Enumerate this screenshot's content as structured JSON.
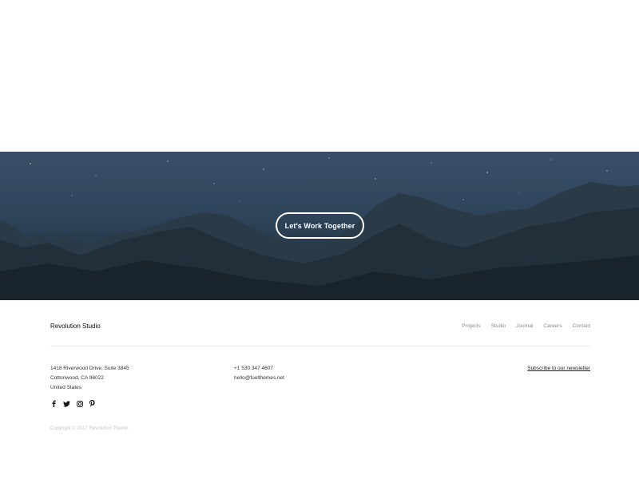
{
  "hero": {
    "cta_label": "Let's Work Together"
  },
  "footer": {
    "brand": "Revolution Studio",
    "nav": [
      "Projects",
      "Studio",
      "Journal",
      "Careers",
      "Contact"
    ],
    "address": [
      "1418 Riverwood Drive, Suite 3845",
      "Cottonwood, CA 96022",
      "United States"
    ],
    "contact": {
      "phone": "+1 530 347 4607",
      "email": "hello@fuelthemes.net"
    },
    "newsletter_label": "Subscribe to our newsletter",
    "social_icons": [
      "facebook-icon",
      "twitter-icon",
      "instagram-icon",
      "pinterest-icon"
    ],
    "copyright": "Copyright © 2017 Revolution Theme."
  },
  "colors": {
    "sky_top": "#3a5068",
    "mountain_dark": "#1b2630",
    "text": "#222222",
    "muted": "#888888"
  }
}
